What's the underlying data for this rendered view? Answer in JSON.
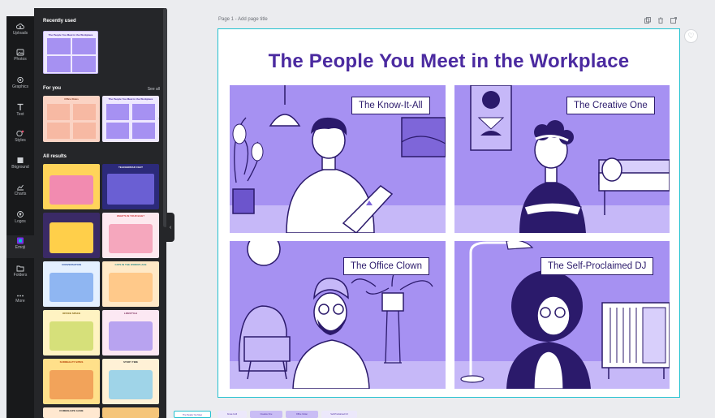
{
  "rail": {
    "items": [
      {
        "label": "Uploads",
        "icon": "upload-cloud-icon"
      },
      {
        "label": "Photos",
        "icon": "photo-icon"
      },
      {
        "label": "Graphics",
        "icon": "shapes-icon"
      },
      {
        "label": "Text",
        "icon": "text-icon"
      },
      {
        "label": "Styles",
        "icon": "palette-icon"
      },
      {
        "label": "Bkground",
        "icon": "background-icon"
      },
      {
        "label": "Charts",
        "icon": "chart-icon"
      },
      {
        "label": "Logos",
        "icon": "logo-icon"
      },
      {
        "label": "Emoji",
        "icon": "emoji-icon"
      },
      {
        "label": "Folders",
        "icon": "folder-icon"
      },
      {
        "label": "More",
        "icon": "more-dots-icon"
      }
    ]
  },
  "panel": {
    "recently_used": "Recently used",
    "for_you": "For you",
    "see_all": "See all",
    "all_results": "All results",
    "recent_thumb_title": "The People You Meet in the Workplace",
    "for_you_thumbs": [
      {
        "title": "Office Roles"
      },
      {
        "title": "The People You Meet in the Workplace"
      }
    ],
    "results": [
      {
        "title": ""
      },
      {
        "title": "TEACHERDAD CHAT"
      },
      {
        "title": ""
      },
      {
        "title": "WHAT'S IN YOUR BAG?"
      },
      {
        "title": "CONVERSATION"
      },
      {
        "title": "CATS IN THE WORKPLACE"
      },
      {
        "title": "OFFICE SPACE"
      },
      {
        "title": "LIFESTYLE"
      },
      {
        "title": "SURREALITY BITES"
      },
      {
        "title": "STORY TIME"
      },
      {
        "title": "DUMBSHAPE GAME"
      },
      {
        "title": ""
      }
    ]
  },
  "canvas": {
    "page_label": "Page 1 - Add page title",
    "title": "The People You Meet in the Workplace",
    "panels": [
      {
        "label": "The Know-It-All"
      },
      {
        "label": "The Creative One"
      },
      {
        "label": "The Office Clown"
      },
      {
        "label": "The Self-Proclaimed DJ"
      }
    ]
  },
  "strip": {
    "pages": [
      {
        "label": "The People You Meet"
      },
      {
        "label": "Know-It-All"
      },
      {
        "label": "Creative One"
      },
      {
        "label": "Office Clown"
      },
      {
        "label": "Self-Proclaimed DJ"
      }
    ]
  },
  "colors": {
    "accent": "#4b2aa0",
    "panel_fill": "#a691f2",
    "selection": "#25c2d0",
    "rail": "#18191b",
    "side_panel": "#252629"
  }
}
